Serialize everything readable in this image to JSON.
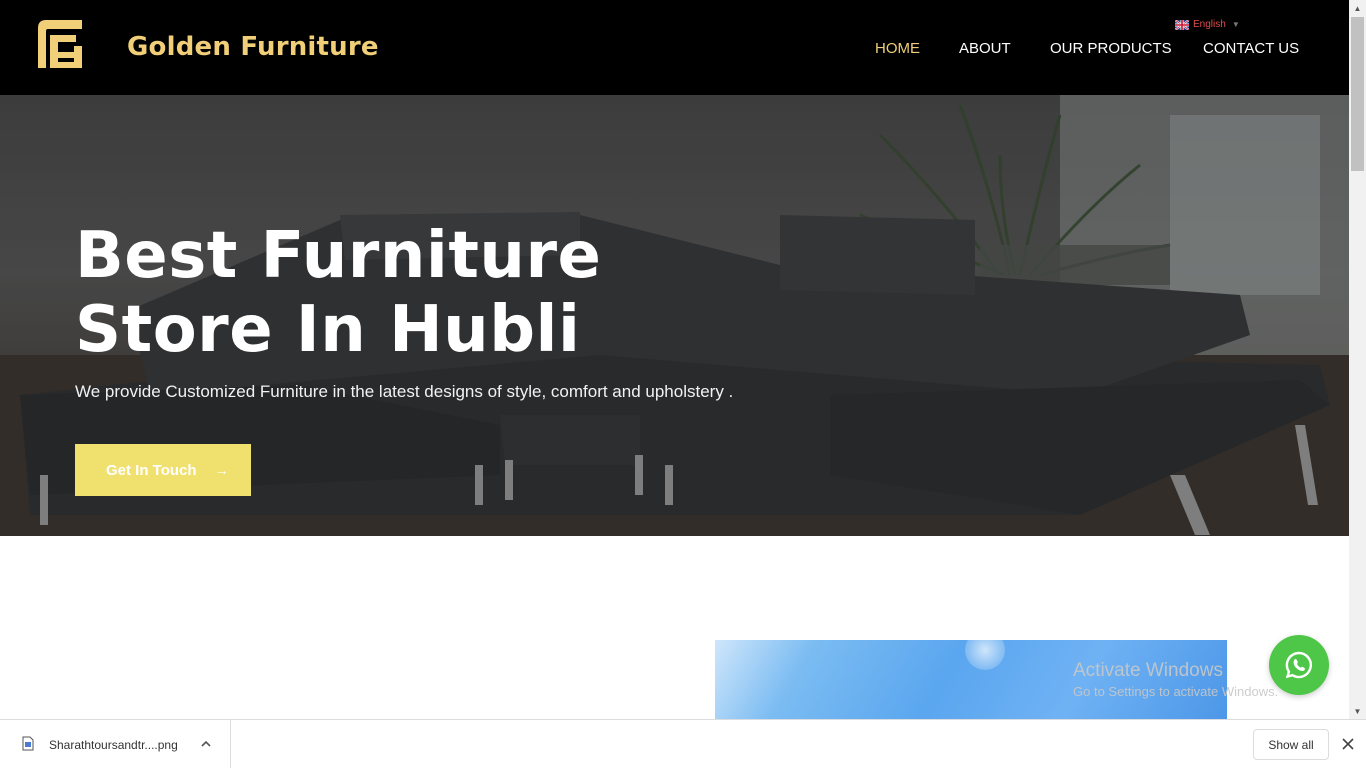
{
  "header": {
    "brand": "Golden Furniture",
    "logo_icon": "golden-furniture-logo",
    "language": {
      "label": "English",
      "flag_icon": "uk-flag-icon",
      "caret": "▼"
    },
    "nav": [
      {
        "label": "HOME",
        "active": true
      },
      {
        "label": "ABOUT",
        "active": false
      },
      {
        "label": "OUR PRODUCTS",
        "active": false
      },
      {
        "label": "CONTACT US",
        "active": false
      }
    ]
  },
  "hero": {
    "title_line1": "Best Furniture",
    "title_line2": "Store In Hubli",
    "subtitle": "We provide Customized Furniture in the latest designs of style, comfort and upholstery .",
    "cta_label": "Get In Touch",
    "cta_arrow": "→"
  },
  "watermark": {
    "line1": "Activate Windows",
    "line2": "Go to Settings to activate Windows."
  },
  "whatsapp_icon": "whatsapp-icon",
  "download_bar": {
    "file_name": "Sharathtoursandtr....png",
    "show_all_label": "Show all"
  },
  "colors": {
    "header_bg": "#000000",
    "brand_gold": "#f0cf78",
    "cta_yellow": "#f0e06e",
    "whatsapp_green": "#4ec647"
  }
}
